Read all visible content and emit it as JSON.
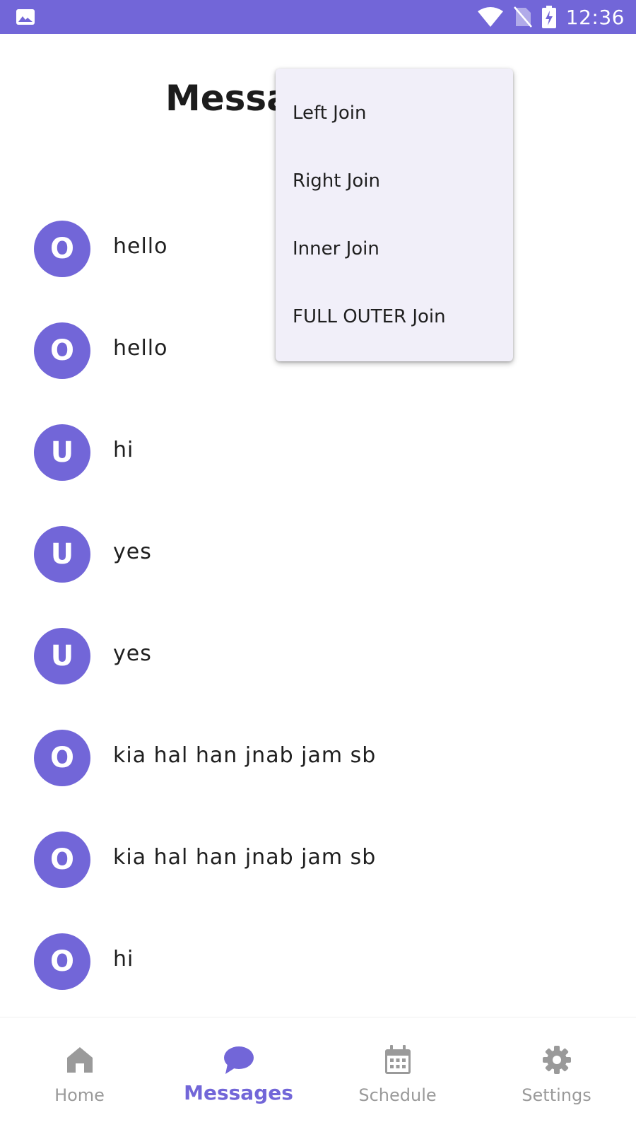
{
  "colors": {
    "accent": "#7266d8",
    "menu_background": "#f1eff9",
    "inactive_nav": "#9a9a9a",
    "text": "#1f1f1f"
  },
  "status_bar": {
    "left_icon": "image-icon",
    "icons": [
      "wifi-icon",
      "no-sim-icon",
      "battery-charging-icon"
    ],
    "time": "12:36"
  },
  "header": {
    "title": "Messages"
  },
  "messages": [
    {
      "avatar": "O",
      "text": "hello"
    },
    {
      "avatar": "O",
      "text": "hello"
    },
    {
      "avatar": "U",
      "text": "hi"
    },
    {
      "avatar": "U",
      "text": "yes"
    },
    {
      "avatar": "U",
      "text": "yes"
    },
    {
      "avatar": "O",
      "text": "kia hal han jnab jam sb"
    },
    {
      "avatar": "O",
      "text": "kia hal han jnab jam sb"
    },
    {
      "avatar": "O",
      "text": "hi"
    }
  ],
  "dropdown": {
    "items": [
      {
        "label": "Left Join"
      },
      {
        "label": "Right Join"
      },
      {
        "label": "Inner Join"
      },
      {
        "label": "FULL OUTER Join"
      }
    ]
  },
  "bottom_nav": {
    "active": "Messages",
    "items": [
      {
        "label": "Home",
        "icon": "home-icon"
      },
      {
        "label": "Messages",
        "icon": "chat-bubble-icon"
      },
      {
        "label": "Schedule",
        "icon": "calendar-icon"
      },
      {
        "label": "Settings",
        "icon": "gear-icon"
      }
    ]
  }
}
